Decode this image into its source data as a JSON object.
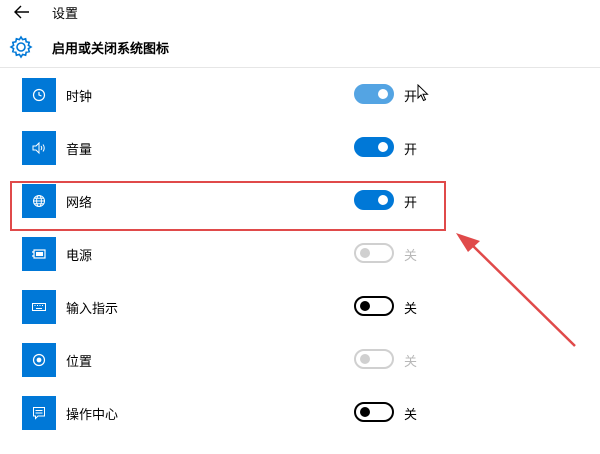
{
  "topbar": {
    "back_icon": "arrow-left-icon",
    "title": "设置"
  },
  "header": {
    "icon": "gear-icon",
    "title": "启用或关闭系统图标"
  },
  "items": [
    {
      "label": "时钟",
      "icon": "clock-icon",
      "state": "开",
      "status": "on-hover"
    },
    {
      "label": "音量",
      "icon": "volume-icon",
      "state": "开",
      "status": "on"
    },
    {
      "label": "网络",
      "icon": "network-icon",
      "state": "开",
      "status": "on"
    },
    {
      "label": "电源",
      "icon": "battery-icon",
      "state": "关",
      "status": "disabled"
    },
    {
      "label": "输入指示",
      "icon": "keyboard-icon",
      "state": "关",
      "status": "off"
    },
    {
      "label": "位置",
      "icon": "location-icon",
      "state": "关",
      "status": "disabled"
    },
    {
      "label": "操作中心",
      "icon": "action-center-icon",
      "state": "关",
      "status": "off"
    }
  ],
  "annotation": {
    "highlighted_item": "网络",
    "color": "#e04a4a"
  },
  "colors": {
    "accent": "#0078d7",
    "accent_hover": "#54a4e3",
    "disabled": "#d0d0d0"
  }
}
